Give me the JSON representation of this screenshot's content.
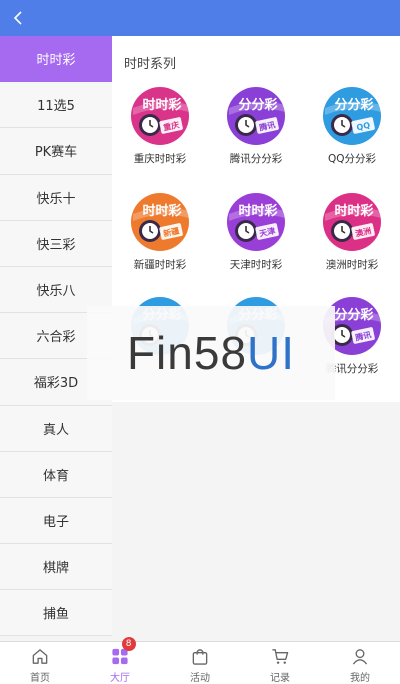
{
  "colors": {
    "header": "#4f7ee8",
    "accent": "#a56af0",
    "badge": "#e23b3b",
    "watermark_blue": "#2f73c9"
  },
  "header": {
    "back_icon": "chevron-left-icon"
  },
  "sidebar": {
    "items": [
      {
        "label": "时时彩",
        "active": true
      },
      {
        "label": "11选5"
      },
      {
        "label": "PK赛车"
      },
      {
        "label": "快乐十"
      },
      {
        "label": "快三彩"
      },
      {
        "label": "快乐八"
      },
      {
        "label": "六合彩"
      },
      {
        "label": "福彩3D"
      },
      {
        "label": "真人"
      },
      {
        "label": "体育"
      },
      {
        "label": "电子"
      },
      {
        "label": "棋牌"
      },
      {
        "label": "捕鱼"
      }
    ]
  },
  "main": {
    "section_title": "时时系列",
    "games": [
      {
        "label": "重庆时时彩",
        "icon_title": "时时彩",
        "icon_tag": "重庆",
        "color": "#d9338a"
      },
      {
        "label": "腾讯分分彩",
        "icon_title": "分分彩",
        "icon_tag": "腾讯",
        "color": "#8a3fd6"
      },
      {
        "label": "QQ分分彩",
        "icon_title": "分分彩",
        "icon_tag": "QQ",
        "color": "#2f9be0"
      },
      {
        "label": "新疆时时彩",
        "icon_title": "时时彩",
        "icon_tag": "新疆",
        "color": "#ee7a2e"
      },
      {
        "label": "天津时时彩",
        "icon_title": "时时彩",
        "icon_tag": "天津",
        "color": "#9a3ed8"
      },
      {
        "label": "澳洲时时彩",
        "icon_title": "时时彩",
        "icon_tag": "澳洲",
        "color": "#dc2f86"
      },
      {
        "label": "",
        "icon_title": "分分彩",
        "icon_tag": "",
        "color": "#2f9be0"
      },
      {
        "label": "",
        "icon_title": "分分彩",
        "icon_tag": "",
        "color": "#2f9be0"
      },
      {
        "label": "腾讯分分彩",
        "icon_title": "分分彩",
        "icon_tag": "腾讯",
        "color": "#8a3fd6"
      }
    ]
  },
  "watermark": {
    "part1": "Fin58",
    "part2": "UI"
  },
  "tabbar": {
    "items": [
      {
        "label": "首页",
        "icon": "home-icon"
      },
      {
        "label": "大厅",
        "icon": "grid-icon",
        "badge": "8",
        "active": true
      },
      {
        "label": "活动",
        "icon": "bag-icon"
      },
      {
        "label": "记录",
        "icon": "cart-icon"
      },
      {
        "label": "我的",
        "icon": "user-icon"
      }
    ]
  }
}
